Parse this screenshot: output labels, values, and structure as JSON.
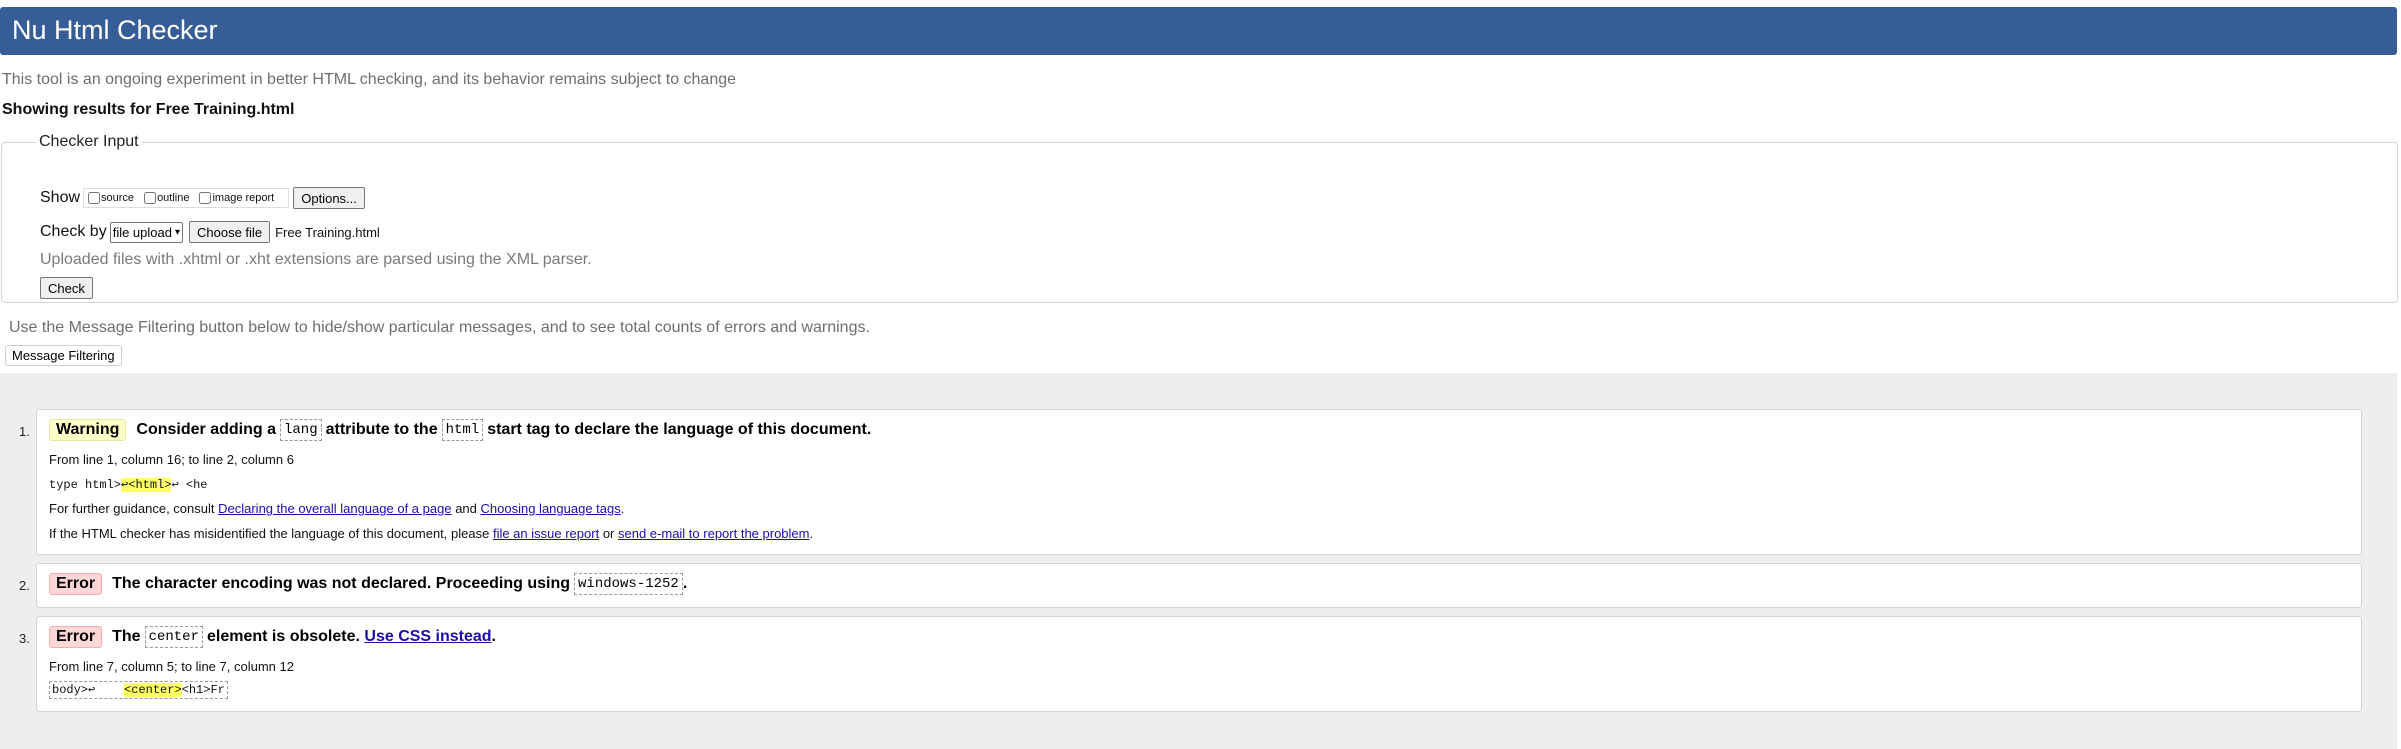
{
  "header": {
    "title": "Nu Html Checker"
  },
  "intro_text": "This tool is an ongoing experiment in better HTML checking, and its behavior remains subject to change",
  "showing_results": "Showing results for Free Training.html",
  "checker": {
    "legend": "Checker Input",
    "show_label": "Show",
    "options": [
      {
        "label": "source",
        "checked": false
      },
      {
        "label": "outline",
        "checked": false
      },
      {
        "label": "image report",
        "checked": false
      }
    ],
    "options_button": "Options...",
    "check_by_label": "Check by",
    "check_by_value": "file upload",
    "choose_file_button": "Choose file",
    "file_name": "Free Training.html",
    "xml_note": "Uploaded files with .xhtml or .xht extensions are parsed using the XML parser.",
    "check_button": "Check"
  },
  "filter_note": "Use the Message Filtering button below to hide/show particular messages, and to see total counts of errors and warnings.",
  "filter_button": "Message Filtering",
  "messages": [
    {
      "number": "1.",
      "type": "Warning",
      "title_parts": [
        "Consider adding a",
        "lang",
        "attribute to the",
        "html",
        "start tag to declare the language of this document."
      ],
      "location": "From line 1, column 16; to line 2, column 6",
      "extract": {
        "before": "type html>",
        "highlight": "↩<html>",
        "after": "↩  <he"
      },
      "guidance_prefix": "For further guidance, consult",
      "guidance_link1": "Declaring the overall language of a page",
      "guidance_and": "and",
      "guidance_link2": "Choosing language tags",
      "guidance_end": ".",
      "misid_prefix": "If the HTML checker has misidentified the language of this document, please",
      "misid_link1": "file an issue report",
      "misid_or": "or",
      "misid_link2": "send e-mail to report the problem",
      "misid_end": "."
    },
    {
      "number": "2.",
      "type": "Error",
      "title_parts": [
        "The character encoding was not declared. Proceeding using",
        "windows-1252",
        "."
      ]
    },
    {
      "number": "3.",
      "type": "Error",
      "title_parts": [
        "The",
        "center",
        "element is obsolete.",
        "Use CSS instead",
        "."
      ],
      "location": "From line 7, column 5; to line 7, column 12",
      "extract": {
        "before": "body>↩    ",
        "highlight": "<center>",
        "after": "<h1>Fr"
      }
    }
  ]
}
